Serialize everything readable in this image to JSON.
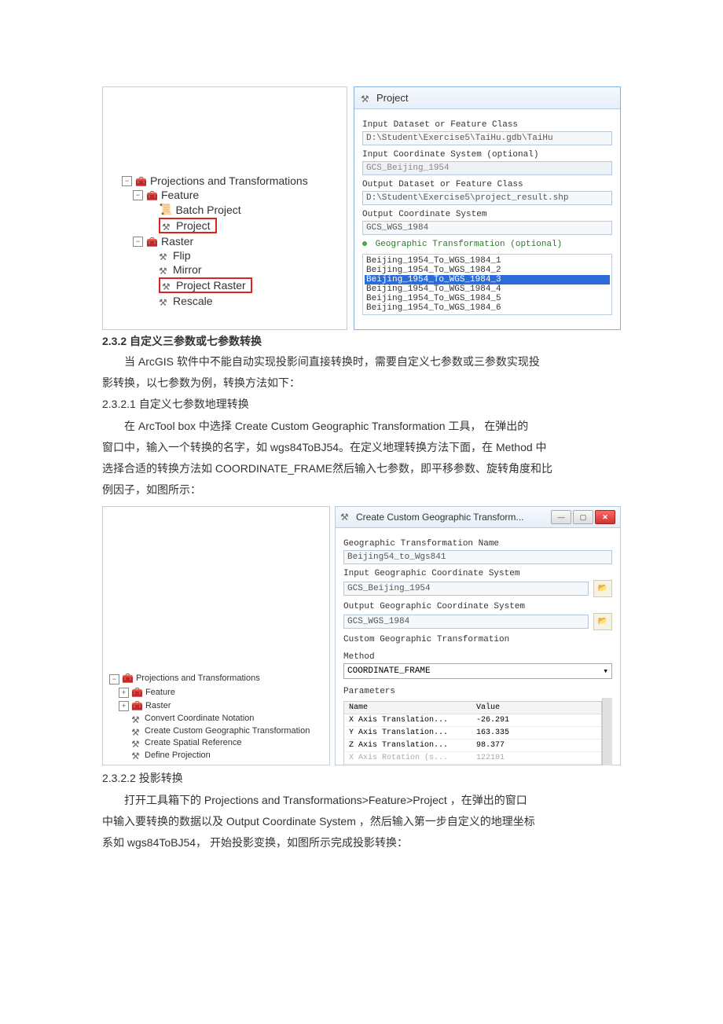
{
  "tree1": {
    "root": "Projections and Transformations",
    "feature": "Feature",
    "batch": "Batch Project",
    "project": "Project",
    "raster": "Raster",
    "flip": "Flip",
    "mirror": "Mirror",
    "project_raster": "Project Raster",
    "rescale": "Rescale"
  },
  "project_panel": {
    "title": "Project",
    "input_ds_lbl": "Input Dataset or Feature Class",
    "input_ds_val": "D:\\Student\\Exercise5\\TaiHu.gdb\\TaiHu",
    "input_cs_lbl": "Input Coordinate System (optional)",
    "input_cs_val": "GCS_Beijing_1954",
    "output_ds_lbl": "Output Dataset or Feature Class",
    "output_ds_val": "D:\\Student\\Exercise5\\project_result.shp",
    "output_cs_lbl": "Output Coordinate System",
    "output_cs_val": "GCS_WGS_1984",
    "geo_trans_lbl": "Geographic Transformation (optional)",
    "geo_list": [
      "Beijing_1954_To_WGS_1984_1",
      "Beijing_1954_To_WGS_1984_2",
      "Beijing_1954_To_WGS_1984_3",
      "Beijing_1954_To_WGS_1984_4",
      "Beijing_1954_To_WGS_1984_5",
      "Beijing_1954_To_WGS_1984_6"
    ],
    "geo_selected_index": 2
  },
  "s232_heading": "2.3.2   自定义三参数或七参数转换",
  "s232_p1a": "当 ArcGIS  软件中不能自动实现投影间直接转换时，需要自定义七参数或三参数实现投",
  "s232_p1b": "影转换，以七参数为例，转换方法如下：",
  "s2321_heading": "2.3.2.1     自定义七参数地理转换",
  "s2321_p1a": "在 ArcTool   box 中选择  Create Custom   Geographic  Transformation          工具，     在弹出的",
  "s2321_p1b": "窗口中，输入一个转换的名字，如       wgs84ToBJ54。在定义地理转换方法下面，在        Method 中",
  "s2321_p1c": "选择合适的转换方法如      COORDINATE_FRAME然后输入七参数，即平移参数、旋转角度和比",
  "s2321_p1d": "例因子，如图所示：",
  "tree2": {
    "root": "Projections and Transformations",
    "feature": "Feature",
    "raster": "Raster",
    "convert": "Convert Coordinate Notation",
    "ccgt": "Create Custom Geographic Transformation",
    "csr": "Create Spatial Reference",
    "dp": "Define Projection"
  },
  "ccgt": {
    "title": "Create Custom Geographic Transform...",
    "name_lbl": "Geographic Transformation Name",
    "name_val": "Beijing54_to_Wgs841",
    "incs_lbl": "Input Geographic Coordinate System",
    "incs_val": "GCS_Beijing_1954",
    "outcs_lbl": "Output Geographic Coordinate System",
    "outcs_val": "GCS_WGS_1984",
    "cgt_lbl": "Custom Geographic Transformation",
    "method_lbl": "Method",
    "method_val": "COORDINATE_FRAME",
    "param_lbl": "Parameters",
    "col_name": "Name",
    "col_value": "Value",
    "params": [
      {
        "name": "X Axis Translation...",
        "value": "-26.291"
      },
      {
        "name": "Y Axis Translation...",
        "value": "163.335"
      },
      {
        "name": "Z Axis Translation...",
        "value": "98.377"
      },
      {
        "name": "X Axis Rotation (s...",
        "value": "122101"
      }
    ]
  },
  "s2322_heading": "2.3.2.2     投影转换",
  "s2322_p1a": "打开工具箱下的     Projections and Transformations>Feature>Project          ，在弹出的窗口",
  "s2322_p1b": "中输入要转换的数据以及       Output Coordinate System      ，然后输入第一步自定义的地理坐标",
  "s2322_p1c": "系如  wgs84ToBJ54， 开始投影变换，如图所示完成投影转换："
}
